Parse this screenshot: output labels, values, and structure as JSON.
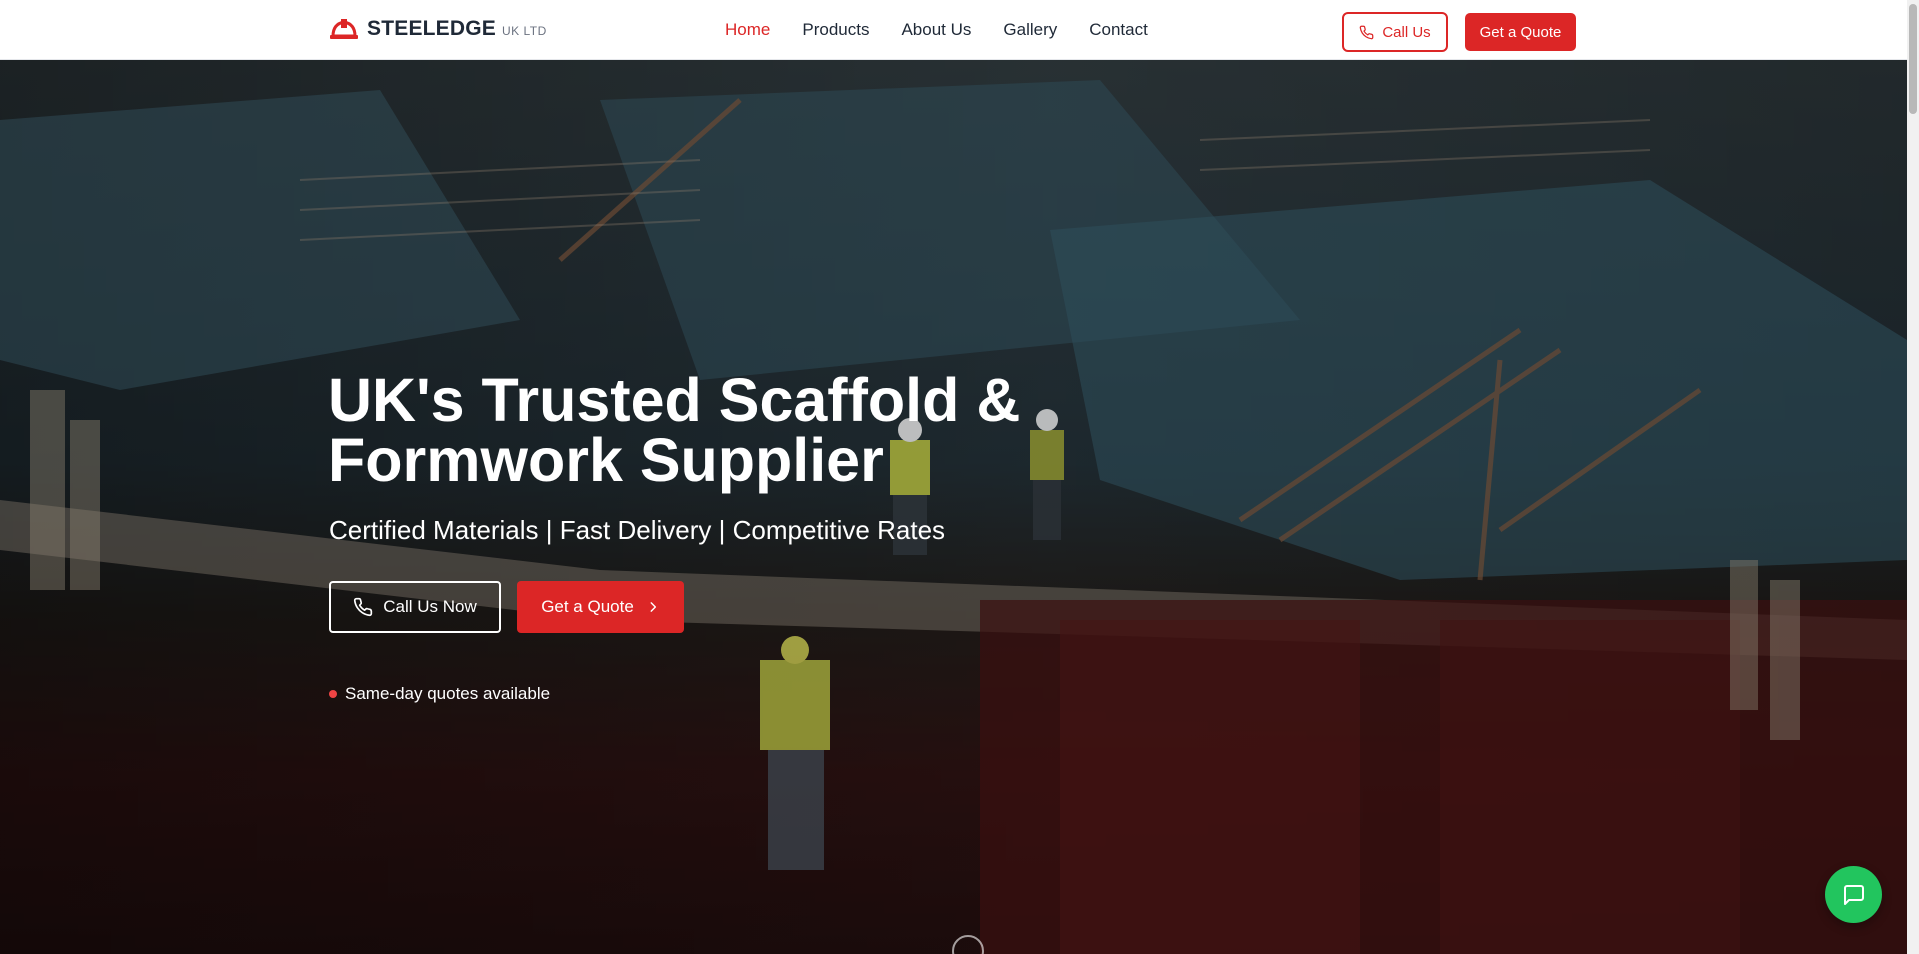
{
  "brand": {
    "name": "STEELEDGE",
    "suffix": "UK LTD",
    "icon": "hard-hat-icon"
  },
  "nav": {
    "items": [
      "Home",
      "Products",
      "About Us",
      "Gallery",
      "Contact"
    ],
    "active": "Home"
  },
  "header_actions": {
    "call_label": "Call Us",
    "quote_label": "Get a Quote"
  },
  "hero": {
    "title_line1": "UK's Trusted Scaffold &",
    "title_line2": "Formwork Supplier",
    "subtitle": "Certified Materials | Fast Delivery | Competitive Rates",
    "call_now_label": "Call Us Now",
    "quote_label": "Get a Quote",
    "badge_text": "Same-day quotes available"
  },
  "chat": {
    "icon": "chat-bubble-icon"
  },
  "colors": {
    "accent": "#dc2626",
    "chat": "#22c55e",
    "text_dark": "#1f2937"
  }
}
